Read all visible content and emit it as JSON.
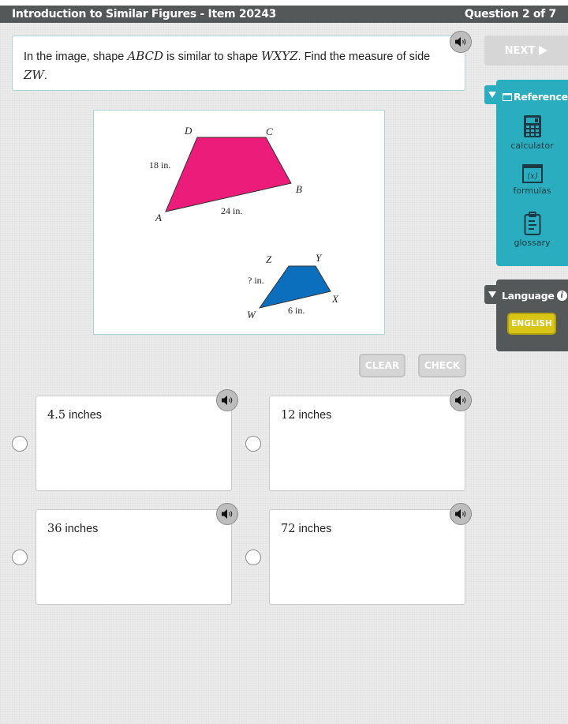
{
  "header": {
    "title": "Introduction to Similar Figures - Item 20243",
    "progress": "Question 2 of 7"
  },
  "question": {
    "text_before": "In the image, shape ",
    "shape1": "ABCD",
    "text_middle": " is similar to shape ",
    "shape2": "WXYZ",
    "text_after": ". Find the measure of side ",
    "side": "ZW",
    "end": "."
  },
  "navigation": {
    "next_label": "NEXT",
    "next_icon": "play-triangle-icon"
  },
  "reference": {
    "title": "Reference",
    "items": [
      {
        "label": "calculator",
        "icon": "calculator-icon"
      },
      {
        "label": "formulas",
        "icon": "formulas-icon"
      },
      {
        "label": "glossary",
        "icon": "clipboard-icon"
      }
    ]
  },
  "language": {
    "title": "Language",
    "selected": "ENGLISH"
  },
  "figure": {
    "large_shape": {
      "vertices": [
        "A",
        "B",
        "C",
        "D"
      ],
      "side_labels": {
        "DA": "18 in.",
        "AB": "24 in."
      },
      "color": "#ec1c7a"
    },
    "small_shape": {
      "vertices": [
        "W",
        "X",
        "Y",
        "Z"
      ],
      "side_labels": {
        "ZW": "? in.",
        "WX": "6 in."
      },
      "color": "#0b6fbe"
    }
  },
  "actions": {
    "clear_label": "CLEAR",
    "check_label": "CHECK"
  },
  "choices": [
    {
      "value": "4.5",
      "unit": " inches",
      "selected": false
    },
    {
      "value": "12",
      "unit": " inches",
      "selected": false
    },
    {
      "value": "36",
      "unit": " inches",
      "selected": false
    },
    {
      "value": "72",
      "unit": " inches",
      "selected": false
    }
  ]
}
